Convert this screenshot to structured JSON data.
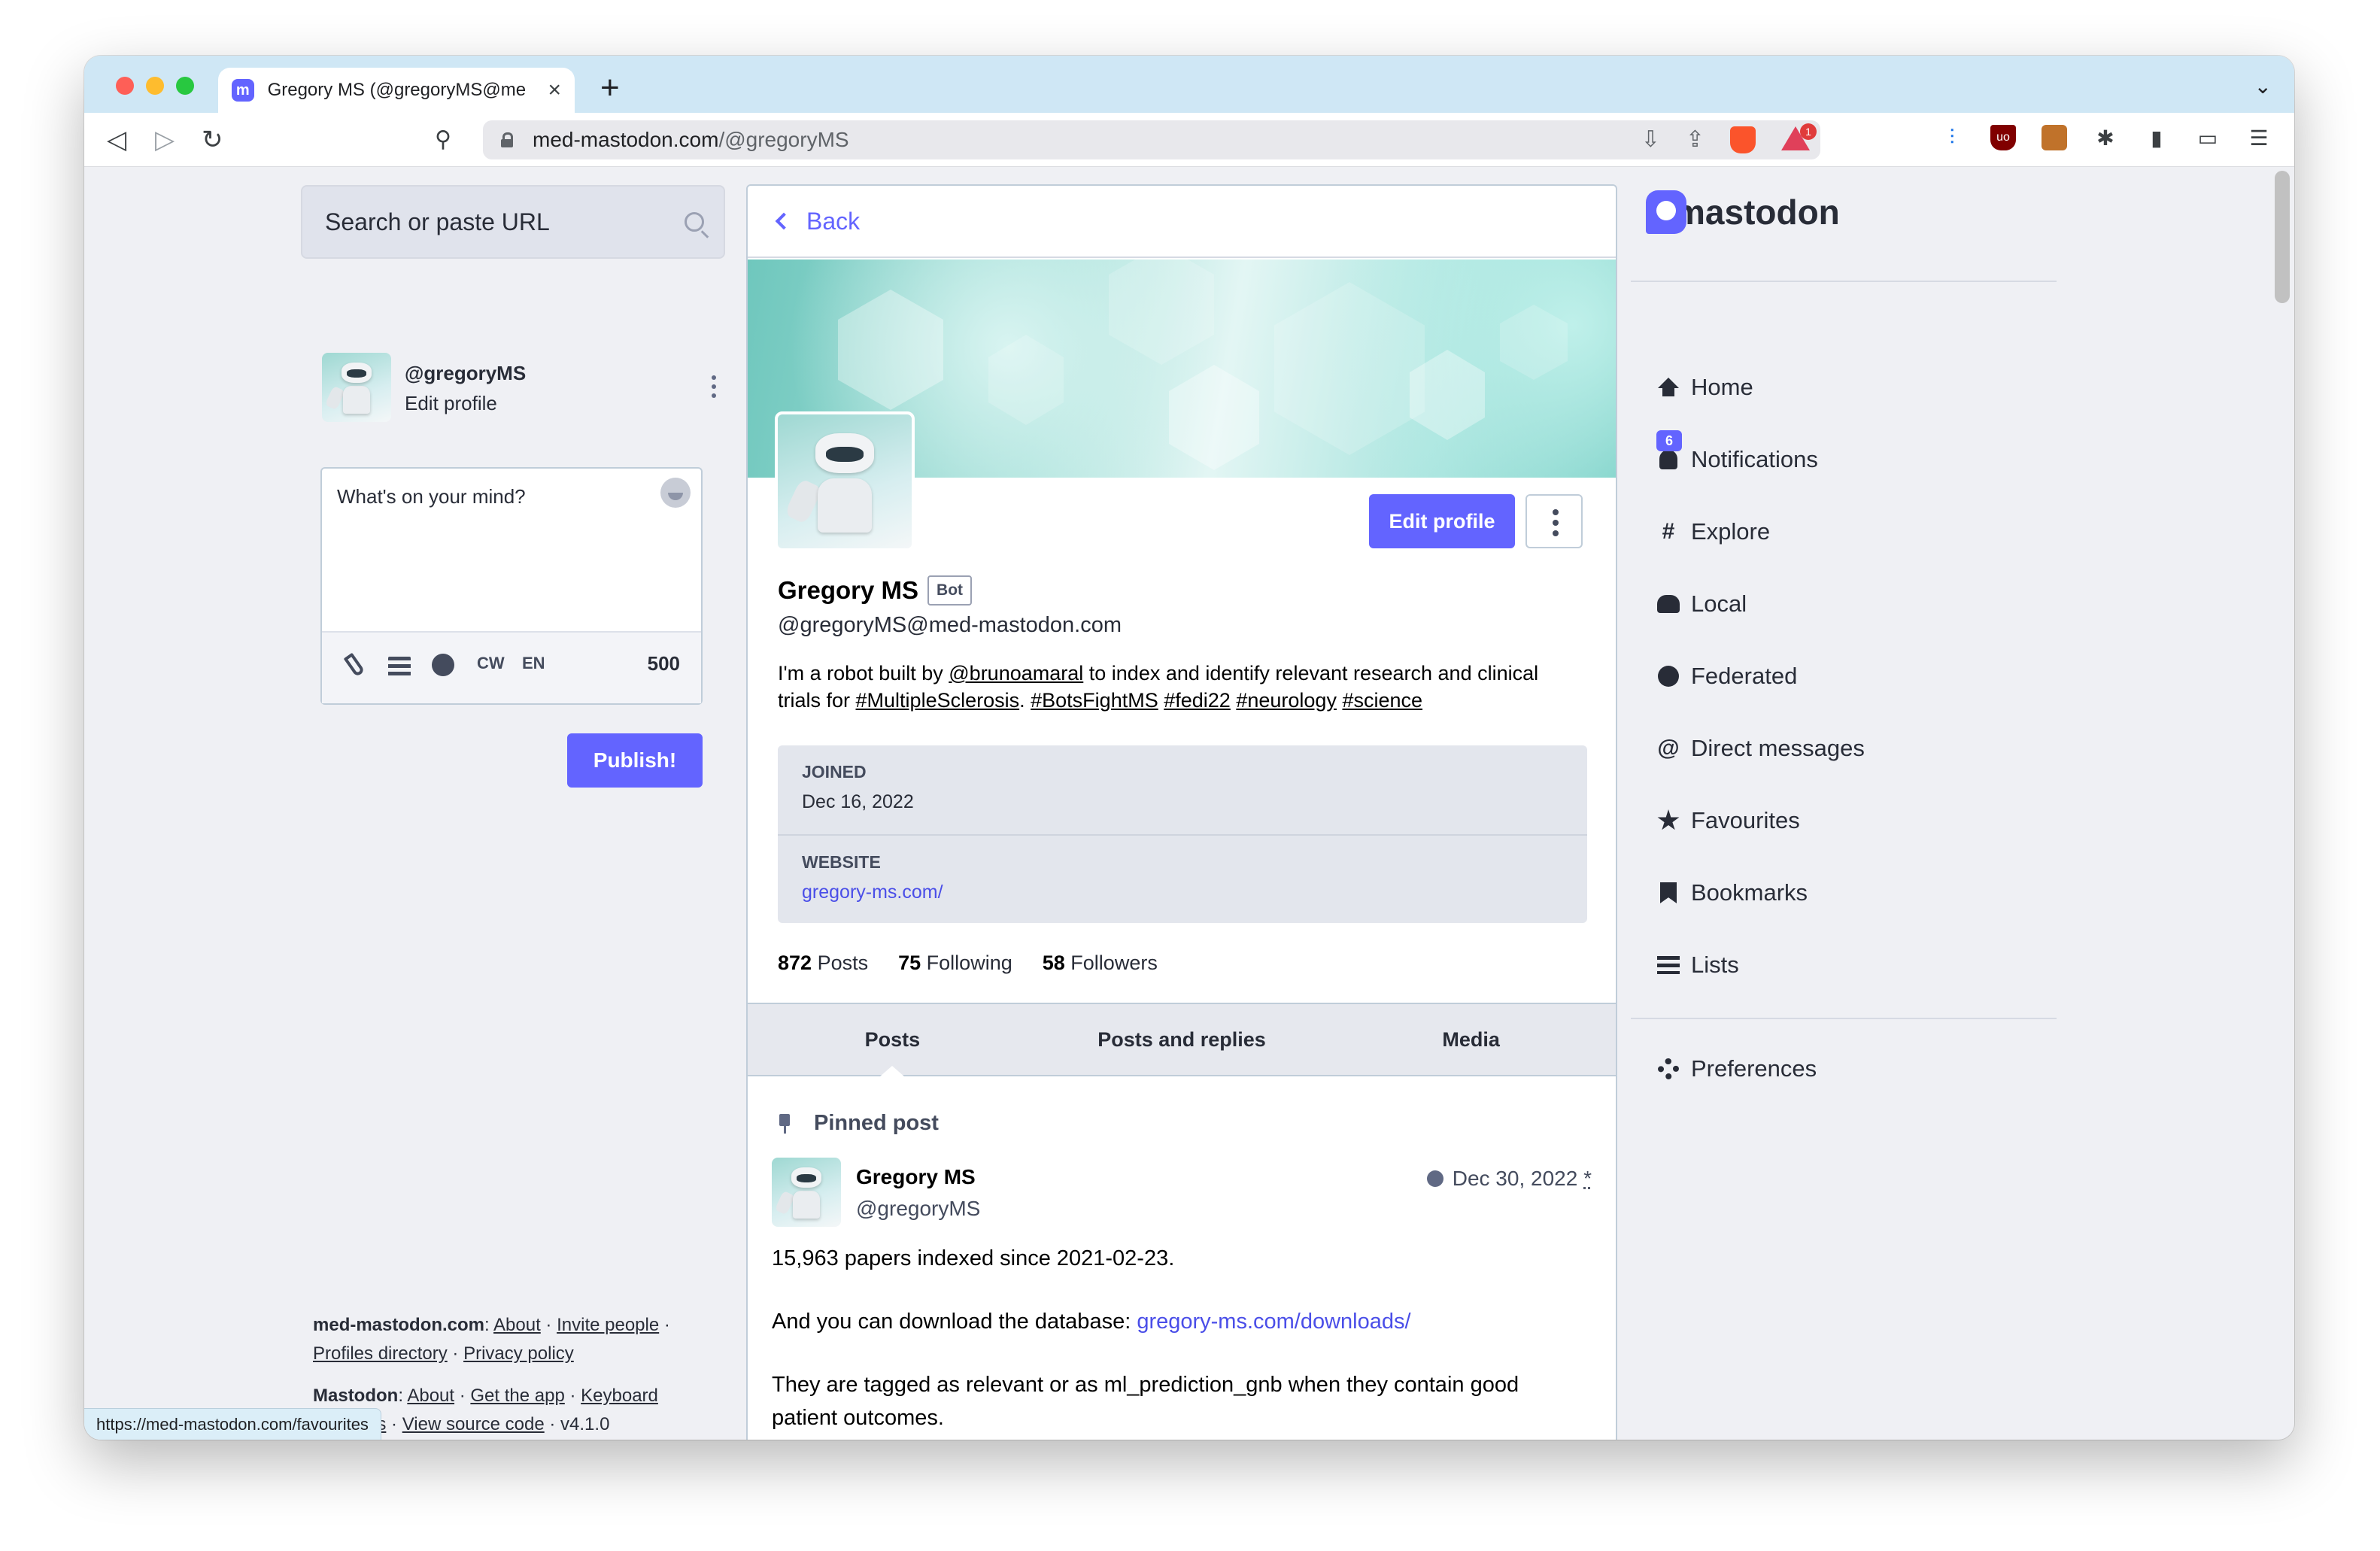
{
  "browser": {
    "tab_title": "Gregory MS (@gregoryMS@me",
    "tab_favicon": "mastodon-icon",
    "url_domain": "med-mastodon.com",
    "url_path": "/@gregoryMS",
    "status_url": "https://med-mastodon.com/favourites",
    "brave_badge": "1"
  },
  "left": {
    "search_placeholder": "Search or paste URL",
    "me_handle": "@gregoryMS",
    "me_edit": "Edit profile",
    "compose_placeholder": "What's on your mind?",
    "cw": "CW",
    "lang": "EN",
    "char_count": "500",
    "publish": "Publish!",
    "footer": {
      "server": "med-mastodon.com",
      "about": "About",
      "invite": "Invite people",
      "directory": "Profiles directory",
      "privacy": "Privacy policy",
      "mastodon": "Mastodon",
      "about2": "About",
      "get_app": "Get the app",
      "keyboard": "Keyboard shortcuts",
      "source": "View source code",
      "version": "v4.1.0"
    }
  },
  "profile": {
    "back": "Back",
    "edit_profile": "Edit profile",
    "display_name": "Gregory MS",
    "bot_badge": "Bot",
    "acct": "@gregoryMS@med-mastodon.com",
    "bio_1": "I'm a robot built by ",
    "bio_mention": "@brunoamaral",
    "bio_2": " to index and identify relevant research and clinical trials for ",
    "bio_tag1": "#MultipleSclerosis",
    "bio_tag2": "#BotsFightMS",
    "bio_tag3": "#fedi22",
    "bio_tag4": "#neurology",
    "bio_tag5": "#science",
    "joined_label": "JOINED",
    "joined_value": "Dec 16, 2022",
    "website_label": "WEBSITE",
    "website_value": "gregory-ms.com/",
    "posts_count": "872",
    "posts_label": "Posts",
    "following_count": "75",
    "following_label": "Following",
    "followers_count": "58",
    "followers_label": "Followers",
    "tabs": [
      "Posts",
      "Posts and replies",
      "Media"
    ],
    "pinned_label": "Pinned post",
    "post": {
      "name": "Gregory MS",
      "handle": "@gregoryMS",
      "date": "Dec 30, 2022",
      "edited_mark": "*",
      "line1": "15,963 papers indexed since 2021-02-23.",
      "line2_prefix": "And you can download the database: ",
      "line2_link": "gregory-ms.com/downloads/",
      "line3": "They are tagged as relevant or as ml_prediction_gnb when they contain good patient outcomes."
    }
  },
  "nav": {
    "logo": "mastodon",
    "notif_count": "6",
    "items": [
      "Home",
      "Notifications",
      "Explore",
      "Local",
      "Federated",
      "Direct messages",
      "Favourites",
      "Bookmarks",
      "Lists"
    ],
    "preferences": "Preferences"
  }
}
